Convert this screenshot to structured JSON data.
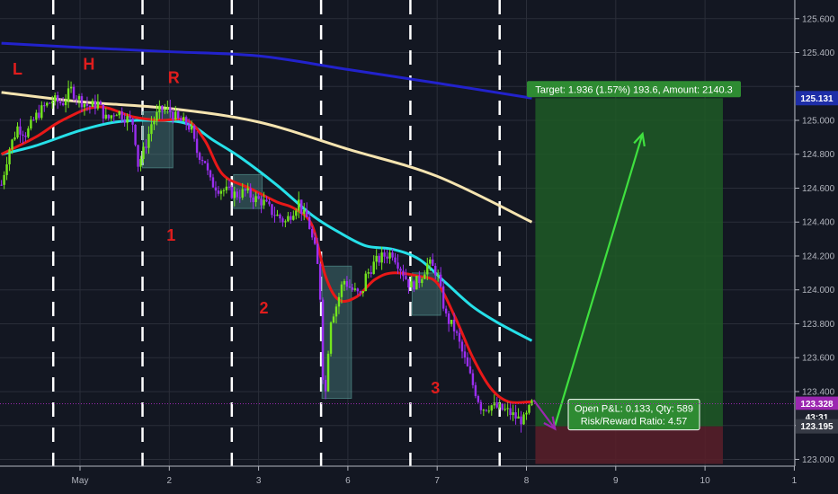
{
  "chart_data": {
    "type": "candlestick",
    "instrument_interval_note": "",
    "y_ticks": [
      123.0,
      123.2,
      123.4,
      123.6,
      123.8,
      124.0,
      124.2,
      124.4,
      124.6,
      124.8,
      125.0,
      125.2,
      125.4,
      125.6
    ],
    "y_tick_labels": [
      "123.000",
      "",
      "123.400",
      "123.600",
      "123.800",
      "124.000",
      "124.200",
      "124.400",
      "124.600",
      "124.800",
      "125.000",
      "",
      "125.400",
      "125.600"
    ],
    "ylim": [
      122.96,
      125.71
    ],
    "xlim": [
      0,
      9.0
    ],
    "x_ticks": [
      {
        "x": 0.0,
        "label": "May"
      },
      {
        "x": 1.0,
        "label": "2"
      },
      {
        "x": 2.0,
        "label": "3"
      },
      {
        "x": 3.0,
        "label": "6"
      },
      {
        "x": 4.0,
        "label": "7"
      },
      {
        "x": 5.0,
        "label": "8"
      },
      {
        "x": 6.0,
        "label": "9"
      },
      {
        "x": 7.0,
        "label": "10"
      },
      {
        "x": 8.0,
        "label": "1"
      }
    ],
    "session_separators": [
      -0.3,
      0.7,
      1.7,
      2.7,
      3.7,
      4.7
    ],
    "price_badges": [
      {
        "value": 125.131,
        "label": "125.131",
        "color": "#1e2ea8"
      },
      {
        "value": 123.328,
        "label": "123.328",
        "color": "#9c27b0"
      },
      {
        "value": 123.25,
        "label": "43:31",
        "color": "#1e222d"
      },
      {
        "value": 123.195,
        "label": "123.195",
        "color": "#363a45"
      }
    ],
    "current_price": 123.328,
    "candles_close_path": [
      [
        -0.88,
        124.62
      ],
      [
        -0.8,
        124.82
      ],
      [
        -0.7,
        124.96
      ],
      [
        -0.6,
        124.92
      ],
      [
        -0.5,
        125.02
      ],
      [
        -0.4,
        125.08
      ],
      [
        -0.3,
        125.12
      ],
      [
        -0.2,
        125.1
      ],
      [
        -0.1,
        125.18
      ],
      [
        0.0,
        125.12
      ],
      [
        0.1,
        125.08
      ],
      [
        0.2,
        125.1
      ],
      [
        0.3,
        125.0
      ],
      [
        0.4,
        125.06
      ],
      [
        0.5,
        125.02
      ],
      [
        0.6,
        124.98
      ],
      [
        0.65,
        124.74
      ],
      [
        0.7,
        124.8
      ],
      [
        0.75,
        124.88
      ],
      [
        0.8,
        124.98
      ],
      [
        0.9,
        125.06
      ],
      [
        1.0,
        125.06
      ],
      [
        1.1,
        125.0
      ],
      [
        1.2,
        124.98
      ],
      [
        1.25,
        124.94
      ],
      [
        1.3,
        124.82
      ],
      [
        1.4,
        124.76
      ],
      [
        1.45,
        124.64
      ],
      [
        1.55,
        124.6
      ],
      [
        1.65,
        124.58
      ],
      [
        1.75,
        124.56
      ],
      [
        1.85,
        124.58
      ],
      [
        1.95,
        124.54
      ],
      [
        2.05,
        124.52
      ],
      [
        2.15,
        124.46
      ],
      [
        2.25,
        124.42
      ],
      [
        2.3,
        124.4
      ],
      [
        2.4,
        124.48
      ],
      [
        2.45,
        124.52
      ],
      [
        2.5,
        124.44
      ],
      [
        2.55,
        124.42
      ],
      [
        2.6,
        124.3
      ],
      [
        2.65,
        124.2
      ],
      [
        2.7,
        123.9
      ],
      [
        2.72,
        123.5
      ],
      [
        2.75,
        123.4
      ],
      [
        2.8,
        123.82
      ],
      [
        2.88,
        123.92
      ],
      [
        2.95,
        124.06
      ],
      [
        3.05,
        124.0
      ],
      [
        3.15,
        123.96
      ],
      [
        3.2,
        124.08
      ],
      [
        3.3,
        124.16
      ],
      [
        3.4,
        124.2
      ],
      [
        3.5,
        124.22
      ],
      [
        3.6,
        124.12
      ],
      [
        3.7,
        124.02
      ],
      [
        3.8,
        124.06
      ],
      [
        3.9,
        124.16
      ],
      [
        4.0,
        124.1
      ],
      [
        4.05,
        123.96
      ],
      [
        4.1,
        123.84
      ],
      [
        4.2,
        123.76
      ],
      [
        4.3,
        123.6
      ],
      [
        4.4,
        123.44
      ],
      [
        4.5,
        123.3
      ],
      [
        4.6,
        123.32
      ],
      [
        4.7,
        123.3
      ],
      [
        4.8,
        123.28
      ],
      [
        4.9,
        123.24
      ],
      [
        4.98,
        123.23
      ],
      [
        5.06,
        123.328
      ]
    ],
    "indicator_series": [
      {
        "color": "#2222cc",
        "points": [
          [
            -0.88,
            125.455
          ],
          [
            0.0,
            125.43
          ],
          [
            1.0,
            125.405
          ],
          [
            2.0,
            125.38
          ],
          [
            3.0,
            125.3
          ],
          [
            4.0,
            125.22
          ],
          [
            5.06,
            125.131
          ]
        ]
      },
      {
        "color": "#f5e4b0",
        "points": [
          [
            -0.88,
            125.165
          ],
          [
            0.0,
            125.11
          ],
          [
            1.0,
            125.07
          ],
          [
            2.0,
            124.99
          ],
          [
            3.0,
            124.83
          ],
          [
            4.0,
            124.67
          ],
          [
            5.06,
            124.4
          ]
        ]
      },
      {
        "color": "#26e0e8",
        "points": [
          [
            -0.88,
            124.8
          ],
          [
            -0.5,
            124.85
          ],
          [
            0.0,
            124.94
          ],
          [
            0.4,
            124.99
          ],
          [
            0.8,
            125.0
          ],
          [
            1.2,
            124.98
          ],
          [
            1.5,
            124.88
          ],
          [
            1.8,
            124.78
          ],
          [
            2.2,
            124.62
          ],
          [
            2.6,
            124.44
          ],
          [
            2.9,
            124.34
          ],
          [
            3.2,
            124.26
          ],
          [
            3.5,
            124.24
          ],
          [
            3.8,
            124.18
          ],
          [
            4.1,
            124.04
          ],
          [
            4.4,
            123.9
          ],
          [
            4.7,
            123.8
          ],
          [
            5.06,
            123.7
          ]
        ]
      },
      {
        "color": "#e81818",
        "points": [
          [
            -0.88,
            124.8
          ],
          [
            -0.5,
            124.9
          ],
          [
            -0.2,
            125.0
          ],
          [
            0.2,
            125.08
          ],
          [
            0.6,
            125.02
          ],
          [
            0.9,
            125.0
          ],
          [
            1.2,
            125.0
          ],
          [
            1.4,
            124.88
          ],
          [
            1.6,
            124.68
          ],
          [
            1.9,
            124.6
          ],
          [
            2.2,
            124.52
          ],
          [
            2.4,
            124.48
          ],
          [
            2.6,
            124.38
          ],
          [
            2.75,
            124.08
          ],
          [
            2.9,
            123.94
          ],
          [
            3.1,
            123.96
          ],
          [
            3.3,
            124.06
          ],
          [
            3.5,
            124.1
          ],
          [
            3.8,
            124.08
          ],
          [
            4.0,
            124.04
          ],
          [
            4.2,
            123.84
          ],
          [
            4.4,
            123.6
          ],
          [
            4.6,
            123.42
          ],
          [
            4.8,
            123.34
          ],
          [
            5.06,
            123.34
          ]
        ]
      }
    ],
    "zones": [
      {
        "x0": 0.7,
        "x1": 1.04,
        "y0": 124.72,
        "y1": 125.05
      },
      {
        "x0": 1.72,
        "x1": 2.04,
        "y0": 124.48,
        "y1": 124.68
      },
      {
        "x0": 2.71,
        "x1": 3.04,
        "y0": 123.36,
        "y1": 124.14
      },
      {
        "x0": 3.72,
        "x1": 4.04,
        "y0": 123.85,
        "y1": 124.1
      }
    ],
    "annotations": [
      {
        "text": "L",
        "x": -0.7,
        "y": 125.27
      },
      {
        "text": "H",
        "x": 0.1,
        "y": 125.3
      },
      {
        "text": "R",
        "x": 1.05,
        "y": 125.22
      },
      {
        "text": "1",
        "x": 1.02,
        "y": 124.29
      },
      {
        "text": "2",
        "x": 2.06,
        "y": 123.86
      },
      {
        "text": "3",
        "x": 3.98,
        "y": 123.39
      }
    ],
    "position_tool": {
      "entry": 123.195,
      "target": 125.131,
      "stop": 122.973,
      "x0": 5.1,
      "x1": 7.2,
      "target_label": "Target: 1.936 (1.57%) 193.6, Amount: 2140.3",
      "pnl_label": "Open P&L: 0.133, Qty: 589",
      "rr_label": "Risk/Reward Ratio: 4.57"
    },
    "projection_arrow": [
      [
        5.32,
        123.2
      ],
      [
        6.3,
        124.92
      ]
    ],
    "small_arrow": [
      [
        5.08,
        123.35
      ],
      [
        5.32,
        123.18
      ]
    ],
    "colors": {
      "background": "#131722",
      "up": "#74e61e",
      "down": "#9a2ef0",
      "grid": "#2a2e39",
      "profit_zone": "#1f5a26",
      "loss_zone": "#5a1f29",
      "zone_box": "#5a9e9a",
      "separator": "#ffffff"
    }
  }
}
